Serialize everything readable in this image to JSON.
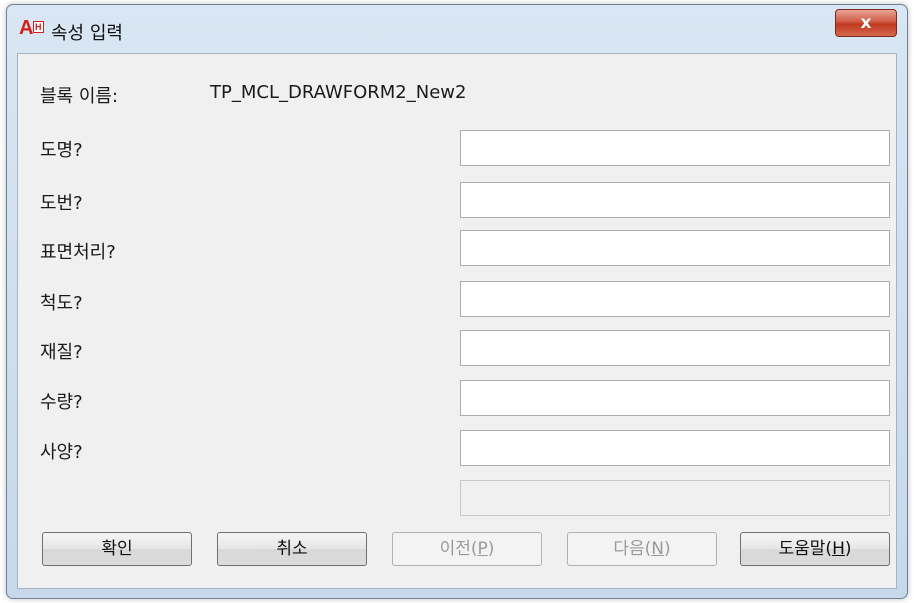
{
  "window": {
    "title": "속성 입력",
    "icon": "autocad-icon",
    "icon_text": "A",
    "icon_sub": "H",
    "close_label": "x"
  },
  "block": {
    "label": "블록 이름:",
    "value": "TP_MCL_DRAWFORM2_New2"
  },
  "fields": [
    {
      "label": "도명?",
      "value": ""
    },
    {
      "label": "도번?",
      "value": ""
    },
    {
      "label": "표면처리?",
      "value": ""
    },
    {
      "label": "척도?",
      "value": ""
    },
    {
      "label": "재질?",
      "value": ""
    },
    {
      "label": "수량?",
      "value": ""
    },
    {
      "label": "사양?",
      "value": ""
    }
  ],
  "extra_field": {
    "value": ""
  },
  "buttons": {
    "ok": "확인",
    "cancel": "취소",
    "prev": "이전",
    "prev_key": "P",
    "next": "다음",
    "next_key": "N",
    "help": "도움말",
    "help_key": "H"
  }
}
